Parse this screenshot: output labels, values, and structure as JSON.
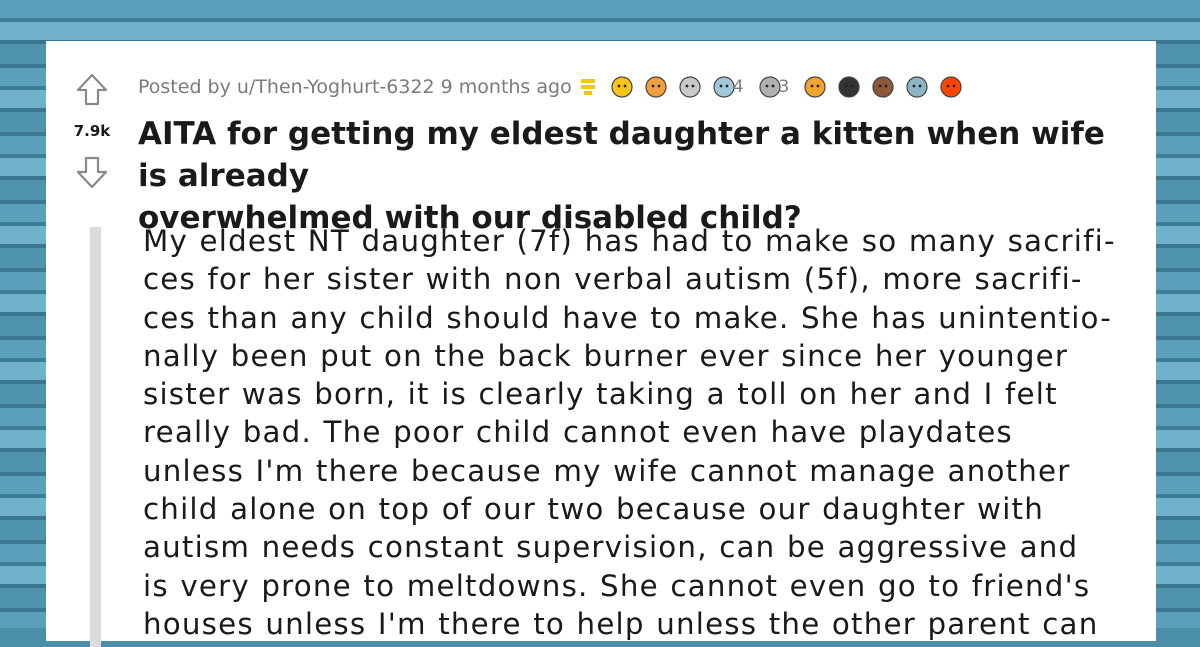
{
  "post": {
    "author_prefix": "Posted by u/Then-Yoghurt-6322",
    "time_ago": "9 months ago",
    "score": "7.9k",
    "title_lines": [
      "AITA for getting my eldest daughter a kitten when wife is already",
      "overwhelmed with our disabled child?"
    ],
    "awards": [
      {
        "icon": "helpful-award-icon",
        "color": "#f5c518"
      },
      {
        "icon": "wholesome-hand-award-icon",
        "color": "#f0a03c"
      },
      {
        "icon": "hugz-award-icon",
        "color": "#c9c9c9"
      },
      {
        "icon": "face-award-icon",
        "color": "#a0c8d8",
        "count": "4"
      },
      {
        "icon": "silver-award-icon",
        "color": "#b0b0b0",
        "count": "3"
      },
      {
        "icon": "kitty-award-icon",
        "color": "#f2a52c"
      },
      {
        "icon": "penguin-award-icon",
        "color": "#333333"
      },
      {
        "icon": "bear-award-icon",
        "color": "#8a5a3a"
      },
      {
        "icon": "hugs-award-icon",
        "color": "#8fb5c4"
      },
      {
        "icon": "snoo-award-icon",
        "color": "#ff4500"
      }
    ],
    "body_lines": [
      "My eldest NT daughter (7f) has had to make so many sacrifi-",
      "ces for her sister with non verbal autism (5f), more sacrifi-",
      "ces than any child should have to make. She has unintentio-",
      "nally been put on the back burner ever since her younger",
      "sister was born, it is clearly taking a toll on her and I felt",
      "really bad. The poor child cannot even have playdates",
      "unless I'm there because my wife cannot manage another",
      "child alone on top of our two because our daughter with",
      "autism needs constant supervision, can be aggressive and",
      "is very prone to meltdowns. She cannot even go to friend's",
      "houses unless I'm there to help unless the other parent can"
    ]
  },
  "colors": {
    "background": "#4a8fa8",
    "card": "#ffffff",
    "text": "#1a1a1b",
    "meta": "#787c7e",
    "pin": "#f5c518"
  }
}
